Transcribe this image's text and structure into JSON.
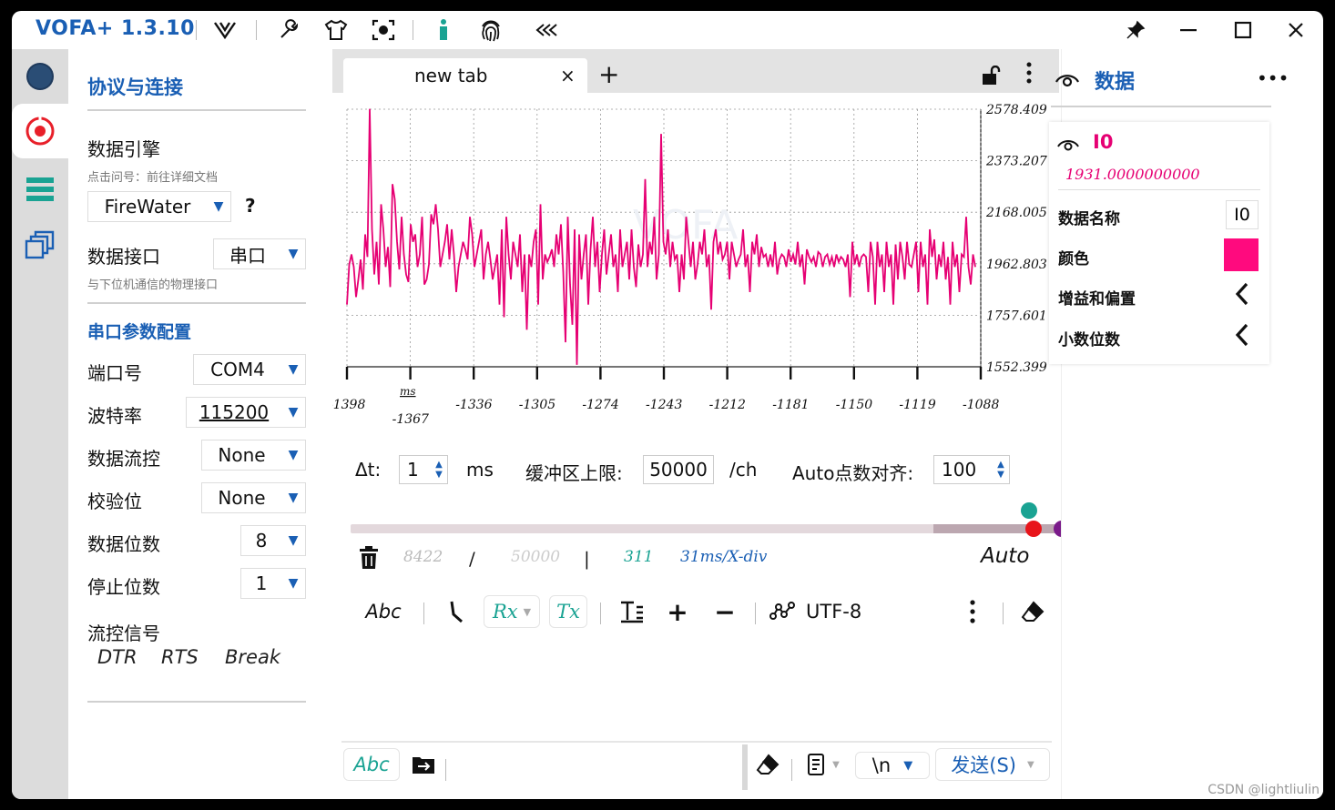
{
  "app": {
    "title": "VOFA+ 1.3.10"
  },
  "colors": {
    "accent": "#1a5fb4",
    "series": "#e60073",
    "teal": "#1aa393"
  },
  "left": {
    "section_title": "协议与连接",
    "engine_label": "数据引擎",
    "engine_hint": "点击问号：前往详细文档",
    "engine_value": "FireWater",
    "help_mark": "?",
    "interface_label": "数据接口",
    "interface_value": "串口",
    "interface_hint": "与下位机通信的物理接口",
    "serial_title": "串口参数配置",
    "port_label": "端口号",
    "port_value": "COM4",
    "baud_label": "波特率",
    "baud_value": "115200",
    "flow_label": "数据流控",
    "flow_value": "None",
    "parity_label": "校验位",
    "parity_value": "None",
    "databits_label": "数据位数",
    "databits_value": "8",
    "stopbits_label": "停止位数",
    "stopbits_value": "1",
    "signal_label": "流控信号",
    "dtr": "DTR",
    "rts": "RTS",
    "brk": "Break"
  },
  "tab": {
    "label": "new tab",
    "close": "×",
    "add": "+"
  },
  "chart_data": {
    "type": "line",
    "y_ticks": [
      "2578.409",
      "2373.207",
      "2168.005",
      "1962.803",
      "1757.601",
      "1552.399"
    ],
    "ylim": [
      1552.399,
      2578.409
    ],
    "x_ticks": [
      "-1398",
      "-1367",
      "-1336",
      "-1305",
      "-1274",
      "-1243",
      "-1212",
      "-1181",
      "-1150",
      "-1119",
      "-1088"
    ],
    "x_unit": "ms",
    "xlim": [
      -1398,
      -1088
    ],
    "series": [
      {
        "name": "I0",
        "color": "#e60073",
        "values": [
          1800,
          1960,
          2000,
          1950,
          1830,
          1900,
          1980,
          1860,
          2080,
          1990,
          2580,
          2100,
          1920,
          2050,
          1880,
          2200,
          2100,
          1950,
          2030,
          1870,
          2280,
          2220,
          2050,
          1940,
          2150,
          2000,
          1920,
          1890,
          2120,
          2050,
          2080,
          1950,
          2000,
          2150,
          1880,
          1900,
          1960,
          2160,
          2120,
          2200,
          2100,
          1950,
          2000,
          2050,
          2120,
          1980,
          2100,
          2000,
          1850,
          1950,
          2000,
          2050,
          2020,
          1980,
          2150,
          2080,
          1950,
          2000,
          2050,
          2100,
          1900,
          2000,
          2050,
          1980,
          1900,
          1950,
          2000,
          1800,
          2100,
          1750,
          2150,
          2000,
          1900,
          2050,
          2000,
          1950,
          2080,
          1850,
          2000,
          1700,
          2000,
          1950,
          2050,
          2100,
          1800,
          2200,
          1900,
          2000,
          1970,
          1990,
          2020,
          1950,
          2080,
          2000,
          2120,
          1930,
          1650,
          2150,
          1880,
          1720,
          2100,
          1560,
          2080,
          1900,
          2000,
          2080,
          1800,
          2020,
          2150,
          1950,
          2050,
          1850,
          2000,
          2100,
          1920,
          2000,
          2080,
          1950,
          2000,
          1850,
          2100,
          1950,
          2000,
          2050,
          1900,
          2100,
          1950,
          1870,
          2040,
          1950,
          2000,
          2300,
          1950,
          2050,
          2000,
          2150,
          1900,
          2000,
          2480,
          2050,
          2000,
          2100,
          1950,
          2050,
          1980,
          2000,
          1850,
          2000,
          1900,
          2150,
          2050,
          1950,
          2050,
          1900,
          1960,
          2050,
          2000,
          2100,
          1950,
          2000,
          1780,
          2050,
          2100,
          2000,
          2050,
          1980,
          2000,
          2050,
          1900,
          2050,
          2000,
          1950,
          1980,
          2000,
          2100,
          1950,
          2000,
          1850,
          2050,
          2000,
          2080,
          1950,
          2030,
          1990,
          2000,
          1950,
          2000,
          1950,
          2050,
          1920,
          1980,
          2000,
          1990,
          1950,
          2020,
          1970,
          2000,
          1960,
          2050,
          1950,
          2000,
          1880,
          2020,
          1990,
          1970,
          1990,
          1950,
          2010,
          2000,
          1950,
          1990,
          2000,
          1960,
          1990,
          1950,
          2000,
          1970,
          1990,
          1980,
          1950,
          2000,
          1830,
          2050,
          1960,
          2000,
          1950,
          1990,
          2000,
          1990,
          1850,
          2050,
          1990,
          1800,
          2050,
          1950,
          2000,
          1850,
          2050,
          1950,
          2000,
          1800,
          2040,
          1900,
          2050,
          1990,
          1900,
          2050,
          1960,
          1950,
          2000,
          2050,
          1850,
          2050,
          1950,
          2000,
          1800,
          2100,
          1990,
          2060,
          1900,
          2000,
          1950,
          2050,
          1900,
          1990,
          1800,
          2050,
          1950,
          2000,
          1850,
          2000,
          1990,
          2150,
          1950,
          1880,
          2000,
          1950
        ]
      }
    ]
  },
  "controls": {
    "delta_label": "Δt:",
    "delta_value": "1",
    "delta_unit": "ms",
    "buffer_label": "缓冲区上限:",
    "buffer_value": "50000",
    "buffer_unit": "/ch",
    "auto_label": "Auto点数对齐:",
    "auto_value": "100"
  },
  "stats": {
    "count": "8422",
    "slash": "/",
    "capacity": "50000",
    "bar": "|",
    "points": "311",
    "per_div": "31ms/X-div",
    "mode": "Auto"
  },
  "toolbar": {
    "abc": "Abc",
    "rx": "Rx",
    "tx": "Tx",
    "plus": "+",
    "minus": "−",
    "encoding": "UTF-8"
  },
  "bottom": {
    "abc": "Abc",
    "newline": "\\n",
    "send": "发送(S)"
  },
  "right": {
    "title": "数据",
    "more": "•••",
    "channel_name": "I0",
    "channel_value": "1931.0000000000",
    "prop_name_label": "数据名称",
    "prop_name_value": "I0",
    "prop_color_label": "颜色",
    "prop_color_value": "#ff0a7e",
    "prop_gain_label": "增益和偏置",
    "prop_decimal_label": "小数位数"
  },
  "watermark": "CSDN @lightliulin"
}
